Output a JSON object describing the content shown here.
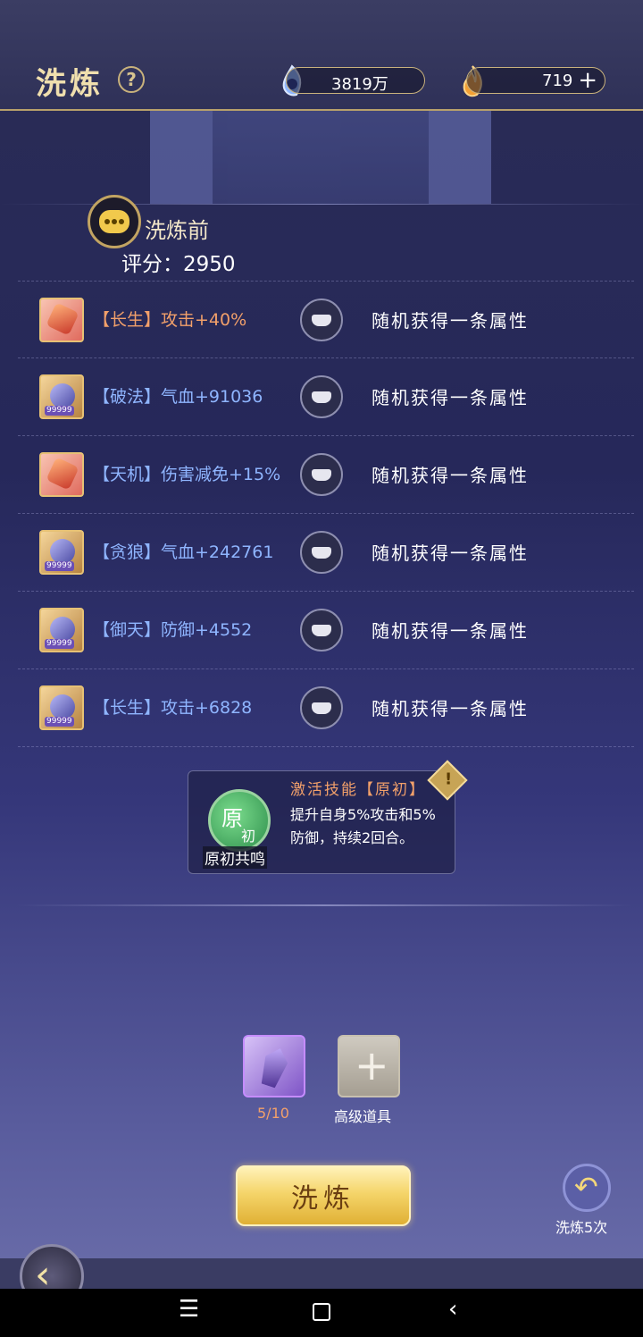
{
  "header": {
    "title": "洗炼",
    "help_icon": "?",
    "currency1": {
      "icon": "spirit-crystal-icon",
      "value": "3819万"
    },
    "currency2": {
      "icon": "flame-icon",
      "value": "719",
      "add": "+"
    }
  },
  "before": {
    "label": "洗炼前",
    "score_label": "评分：",
    "score": "2950"
  },
  "attributes": [
    {
      "text": "【长生】攻击+40%",
      "color": "orange",
      "gem": "red",
      "result": "随机获得一条属性"
    },
    {
      "text": "【破法】气血+91036",
      "color": "blue",
      "gem": "gold",
      "badge": "99999",
      "result": "随机获得一条属性"
    },
    {
      "text": "【天机】伤害减免+15%",
      "color": "blue",
      "gem": "red",
      "result": "随机获得一条属性"
    },
    {
      "text": "【贪狼】气血+242761",
      "color": "blue",
      "gem": "gold",
      "badge": "99999",
      "result": "随机获得一条属性"
    },
    {
      "text": "【御天】防御+4552",
      "color": "blue",
      "gem": "gold",
      "badge": "99999",
      "result": "随机获得一条属性"
    },
    {
      "text": "【长生】攻击+6828",
      "color": "blue",
      "gem": "gold",
      "badge": "99999",
      "result": "随机获得一条属性"
    }
  ],
  "skill": {
    "icon_main": "原",
    "icon_sub": "初",
    "name": "原初共鸣",
    "title": "激活技能【原初】",
    "desc": "提升自身5%攻击和5%防御，持续2回合。",
    "warn": "!"
  },
  "items": {
    "crystal_count": "5/10",
    "advanced_label": "高级道具"
  },
  "actions": {
    "refine": "洗炼",
    "repeat_label": "洗炼5次"
  },
  "colors": {
    "accent_gold": "#f0dfae",
    "orange_text": "#f2a06a",
    "blue_text": "#8fb5ff"
  }
}
